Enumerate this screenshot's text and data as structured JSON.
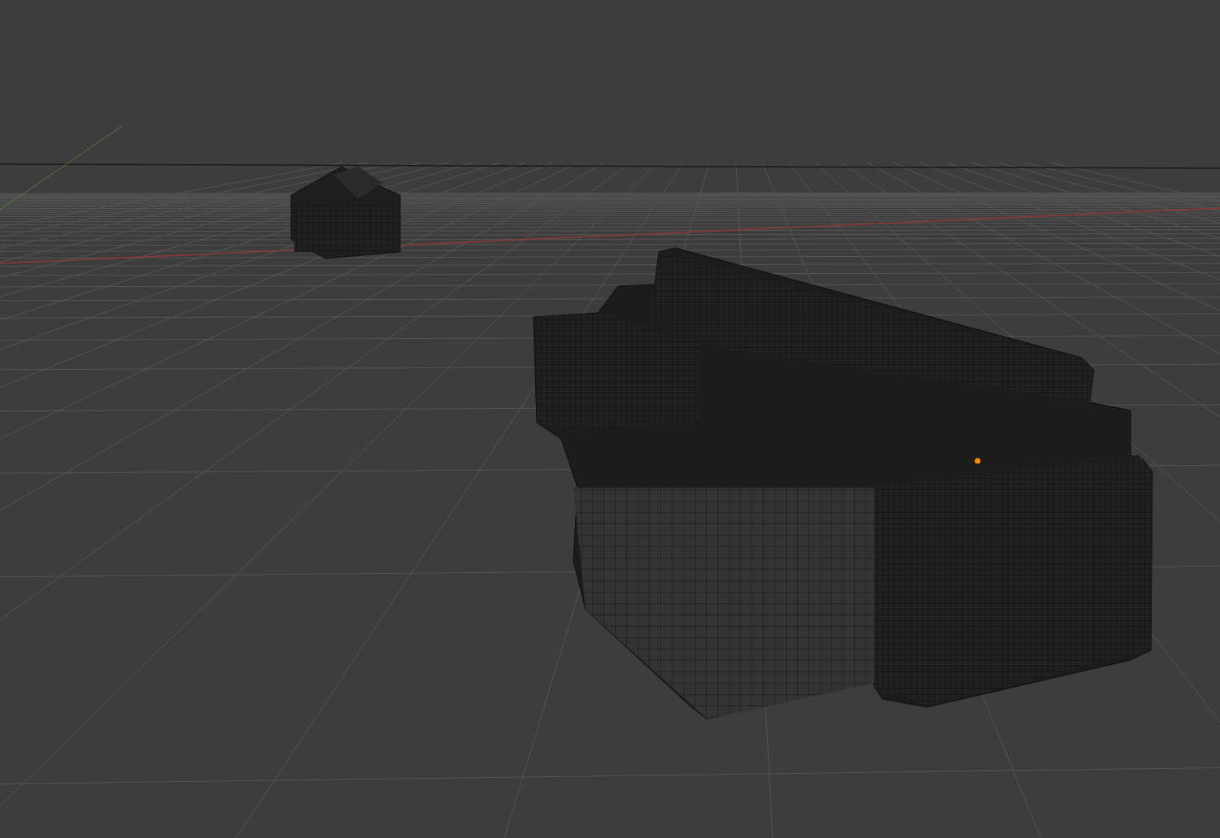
{
  "viewport": {
    "objects": [
      {
        "kind": "armchair"
      },
      {
        "kind": "sectional-sofa"
      }
    ]
  }
}
